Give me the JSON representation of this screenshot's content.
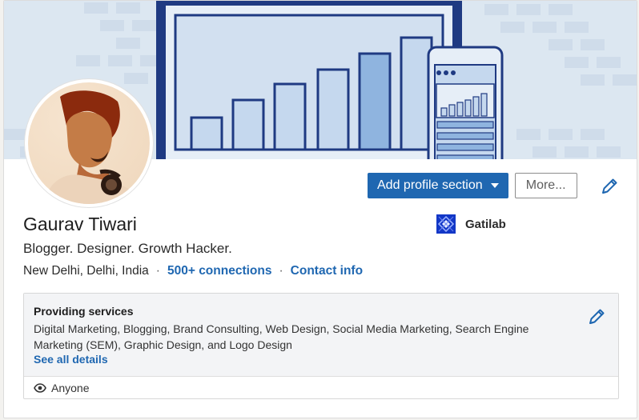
{
  "profile": {
    "name": "Gaurav Tiwari",
    "headline": "Blogger. Designer. Growth Hacker.",
    "location": "New Delhi, Delhi, India",
    "separator": "·",
    "connections": "500+ connections",
    "contact_info": "Contact info"
  },
  "actions": {
    "add_section_label": "Add profile section",
    "more_label": "More..."
  },
  "company": {
    "name": "Gatilab",
    "logo_color": "#1237c7"
  },
  "services": {
    "title": "Providing services",
    "list": "Digital Marketing, Blogging, Brand Consulting, Web Design, Social Media Marketing, Search Engine Marketing (SEM), Graphic Design, and Logo Design",
    "see_all": "See all details",
    "visibility": "Anyone"
  },
  "icons": {
    "edit": "pencil-icon",
    "visibility": "eye-icon",
    "dropdown": "caret-down-icon"
  },
  "colors": {
    "accent": "#1f67b1",
    "banner_bg": "#dce7f1",
    "banner_dark": "#1f3a82"
  }
}
